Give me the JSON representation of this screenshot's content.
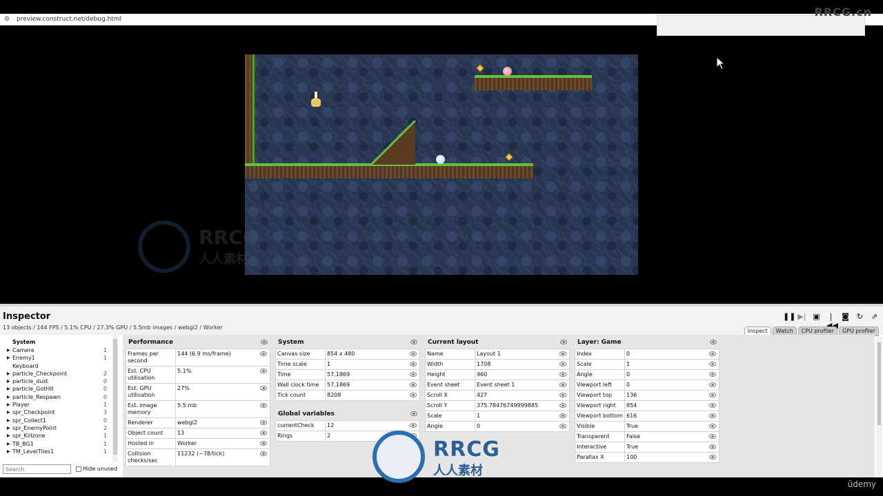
{
  "browser": {
    "url": "preview.construct.net/debug.html",
    "watermark_top": "RRCG.cn"
  },
  "watermark": {
    "name": "RRCG",
    "subtitle": "人人素材"
  },
  "inspector": {
    "title": "Inspector",
    "status": "13 objects / 144 FPS / 5.1% CPU / 27.3% GPU / 5.5mb images / webgl2 / Worker",
    "toolbar": [
      "pause-icon",
      "step-icon",
      "save-icon",
      "restart-icon",
      "camera-icon",
      "reload-icon",
      "popout-icon"
    ],
    "tabs": [
      "Inspect",
      "Watch",
      "CPU profiler",
      "GPU profiler"
    ],
    "active_tab": "Inspect",
    "tree": {
      "head": "System",
      "items": [
        {
          "label": "Camera",
          "count": "1",
          "expand": true
        },
        {
          "label": "Enemy1",
          "count": "1",
          "expand": true
        },
        {
          "label": "Keyboard",
          "count": "",
          "expand": false
        },
        {
          "label": "particle_Checkpoint",
          "count": "2",
          "expand": true
        },
        {
          "label": "particle_dust",
          "count": "0",
          "expand": true
        },
        {
          "label": "particle_GotHit",
          "count": "0",
          "expand": true
        },
        {
          "label": "particle_Respawn",
          "count": "0",
          "expand": true
        },
        {
          "label": "Player",
          "count": "1",
          "expand": true
        },
        {
          "label": "spr_Checkpoint",
          "count": "3",
          "expand": true
        },
        {
          "label": "spr_Collect1",
          "count": "0",
          "expand": true
        },
        {
          "label": "spr_EnemyPoint",
          "count": "2",
          "expand": true
        },
        {
          "label": "spr_Killzone",
          "count": "1",
          "expand": true
        },
        {
          "label": "TB_BG1",
          "count": "1",
          "expand": true
        },
        {
          "label": "TM_LevelTiles1",
          "count": "1",
          "expand": true
        }
      ]
    },
    "search_placeholder": "Search",
    "hide_unused": "Hide unused",
    "performance": {
      "title": "Performance",
      "rows": [
        {
          "k": "Frames per second",
          "v": "144 (6.9 ms/frame)"
        },
        {
          "k": "Est. CPU utilisation",
          "v": "5.1%"
        },
        {
          "k": "Est. GPU utilisation",
          "v": "27%"
        },
        {
          "k": "Est. image memory",
          "v": "5.5 mb"
        },
        {
          "k": "Renderer",
          "v": "webgl2"
        },
        {
          "k": "Object count",
          "v": "13"
        },
        {
          "k": "Hosted in",
          "v": "Worker"
        },
        {
          "k": "Collision checks/sec",
          "v": "11232 (~78/tick)"
        }
      ]
    },
    "system": {
      "title": "System",
      "rows": [
        {
          "k": "Canvas size",
          "v": "854 x 480"
        },
        {
          "k": "Time scale",
          "v": "1"
        },
        {
          "k": "Time",
          "v": "57.1869"
        },
        {
          "k": "Wall clock time",
          "v": "57.1869"
        },
        {
          "k": "Tick count",
          "v": "8208"
        }
      ]
    },
    "globals": {
      "title": "Global variables",
      "rows": [
        {
          "k": "currentCheck",
          "v": "12"
        },
        {
          "k": "Rings",
          "v": "2"
        }
      ]
    },
    "layout": {
      "title": "Current layout",
      "rows": [
        {
          "k": "Name",
          "v": "Layout 1"
        },
        {
          "k": "Width",
          "v": "1708"
        },
        {
          "k": "Height",
          "v": "960"
        },
        {
          "k": "Event sheet",
          "v": "Event sheet 1"
        },
        {
          "k": "Scroll X",
          "v": "427"
        },
        {
          "k": "Scroll Y",
          "v": "375.78476749999885"
        },
        {
          "k": "Scale",
          "v": "1"
        },
        {
          "k": "Angle",
          "v": "0"
        }
      ]
    },
    "layer": {
      "title": "Layer: Game",
      "rows": [
        {
          "k": "Index",
          "v": "0"
        },
        {
          "k": "Scale",
          "v": "1"
        },
        {
          "k": "Angle",
          "v": "0"
        },
        {
          "k": "Viewport left",
          "v": "0"
        },
        {
          "k": "Viewport top",
          "v": "136"
        },
        {
          "k": "Viewport right",
          "v": "854"
        },
        {
          "k": "Viewport bottom",
          "v": "616"
        },
        {
          "k": "Visible",
          "v": "True"
        },
        {
          "k": "Transparent",
          "v": "False"
        },
        {
          "k": "Interactive",
          "v": "True"
        },
        {
          "k": "Parallax X",
          "v": "100"
        }
      ]
    }
  },
  "udemy": "ûdemy"
}
